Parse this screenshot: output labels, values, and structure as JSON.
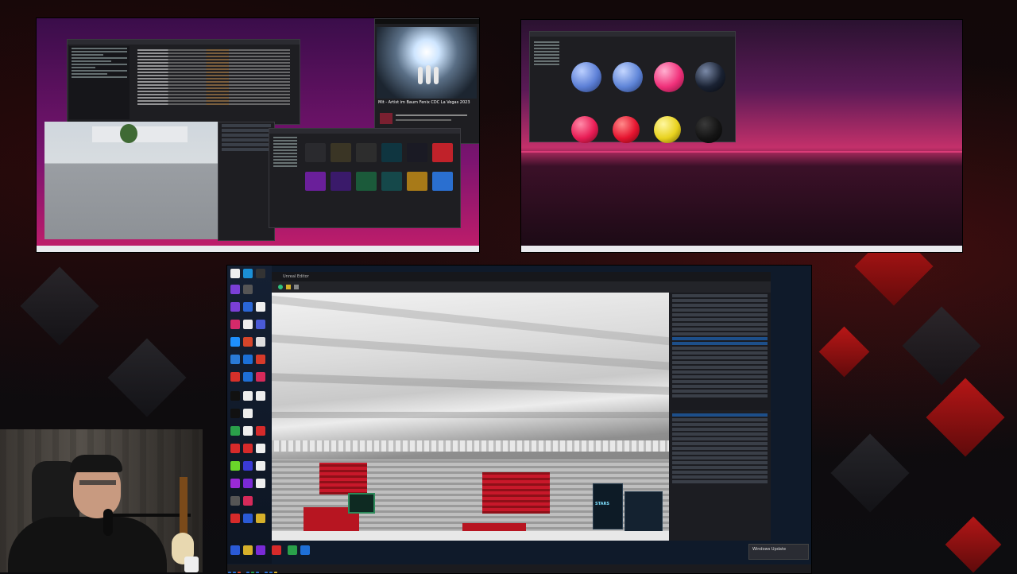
{
  "top_left_monitor": {
    "video_overlay": {
      "title": "Mit - Artist im Baum Fenix CDC La Vegas 2023"
    }
  },
  "top_right_monitor": {
    "material_browser": {
      "sphere_colors": [
        "#5c7fd6",
        "#5f85d8",
        "#f0307a",
        "#1a2233",
        "#e81c55",
        "#e6142f",
        "#e8d21e",
        "#141414"
      ]
    }
  },
  "main_monitor": {
    "editor": {
      "window_title": "Unreal Editor",
      "scene": "stadium",
      "sponsor_banner_text": "STARS"
    },
    "notification": {
      "text": "Windows Update"
    }
  },
  "colors": {
    "accent_red": "#d01818",
    "seat_red": "#c8182a",
    "panel_dark": "#1e1f24",
    "selection_blue": "#1d4f8a"
  }
}
